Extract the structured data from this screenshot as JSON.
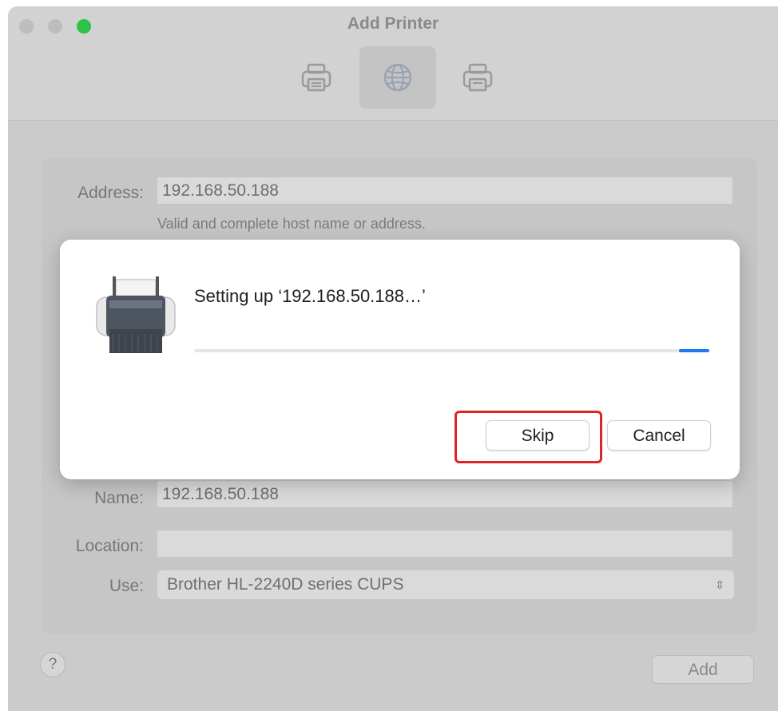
{
  "window": {
    "title": "Add Printer",
    "toolbar": [
      {
        "icon": "printer-icon",
        "selected": false
      },
      {
        "icon": "globe-icon",
        "selected": true
      },
      {
        "icon": "printer-icon",
        "selected": false
      }
    ]
  },
  "form": {
    "address_label": "Address:",
    "address_value": "192.168.50.188",
    "address_hint": "Valid and complete host name or address.",
    "name_label": "Name:",
    "name_value": "192.168.50.188",
    "location_label": "Location:",
    "location_value": "",
    "use_label": "Use:",
    "use_value": "Brother HL-2240D series CUPS"
  },
  "footer": {
    "help_label": "?",
    "add_label": "Add"
  },
  "dialog": {
    "message": "Setting up ‘192.168.50.188…’",
    "skip_label": "Skip",
    "cancel_label": "Cancel",
    "progress_indeterminate": true
  },
  "colors": {
    "accent": "#1a7cf0",
    "highlight": "#e02424",
    "zoom": "#2fc24a"
  }
}
